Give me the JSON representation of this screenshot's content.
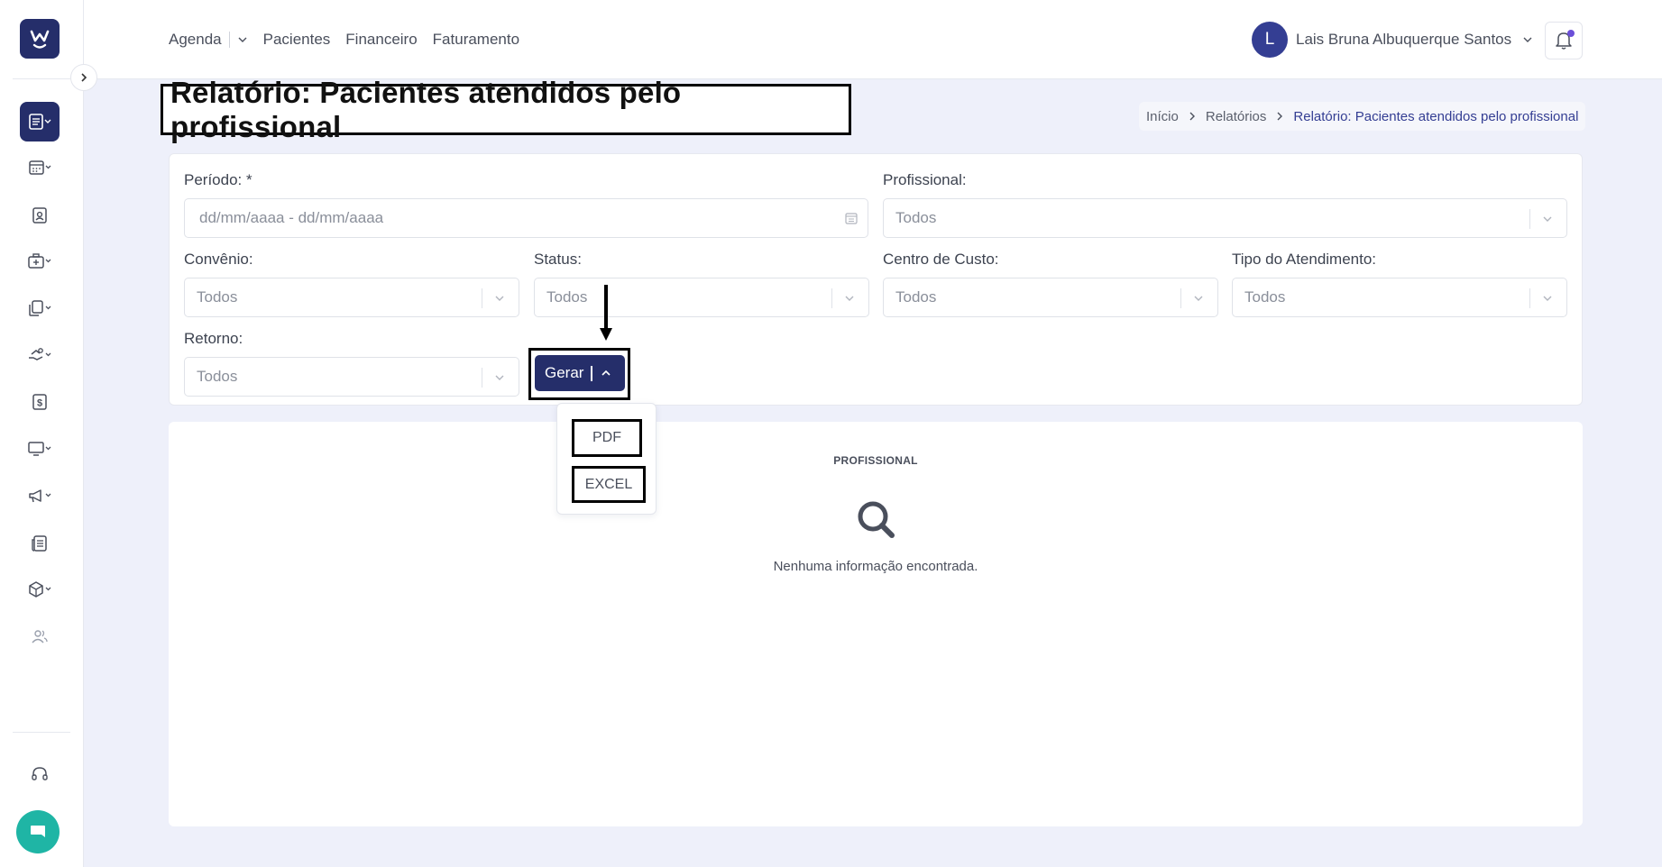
{
  "app": {
    "logo_letter": "W",
    "accent_color": "#252e6a",
    "chat_color": "#1fb5a5"
  },
  "nav": {
    "items": [
      "Agenda",
      "Pacientes",
      "Financeiro",
      "Faturamento"
    ]
  },
  "user": {
    "avatar_initial": "L",
    "name": "Lais Bruna Albuquerque Santos"
  },
  "sidebar": {
    "icons": [
      "report-icon",
      "calendar-icon",
      "patient-badge-icon",
      "medical-case-icon",
      "documents-icon",
      "hand-money-icon",
      "dollar-sign-icon",
      "monitor-icon",
      "megaphone-icon",
      "newspaper-icon",
      "box-icon",
      "users-icon",
      "headset-icon"
    ]
  },
  "page": {
    "title": "Relatório: Pacientes atendidos pelo profissional"
  },
  "breadcrumb": {
    "items": [
      "Início",
      "Relatórios",
      "Relatório: Pacientes atendidos pelo profissional"
    ]
  },
  "filters": {
    "periodo": {
      "label": "Período: *",
      "placeholder": "dd/mm/aaaa - dd/mm/aaaa"
    },
    "profissional": {
      "label": "Profissional:",
      "value": "Todos"
    },
    "convenio": {
      "label": "Convênio:",
      "value": "Todos"
    },
    "status": {
      "label": "Status:",
      "value": "Todos"
    },
    "centro_custo": {
      "label": "Centro de Custo:",
      "value": "Todos"
    },
    "tipo_atendimento": {
      "label": "Tipo do Atendimento:",
      "value": "Todos"
    },
    "retorno": {
      "label": "Retorno:",
      "value": "Todos"
    }
  },
  "actions": {
    "gerar_label": "Gerar",
    "menu": [
      "PDF",
      "EXCEL"
    ]
  },
  "results": {
    "column": "PROFISSIONAL",
    "empty_message": "Nenhuma informação encontrada."
  }
}
